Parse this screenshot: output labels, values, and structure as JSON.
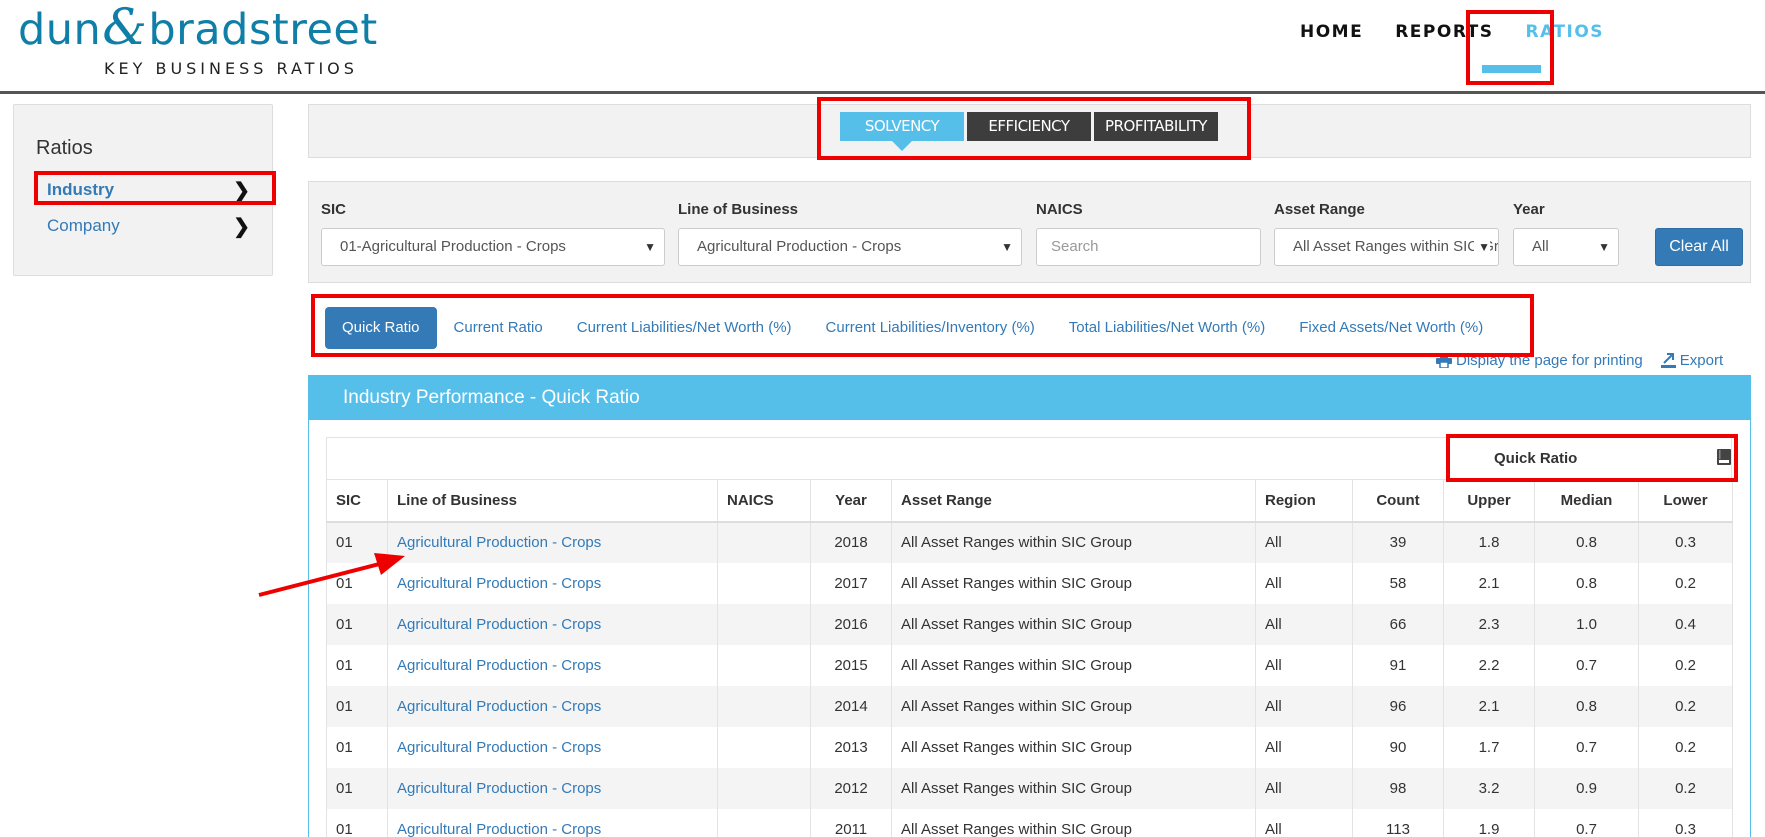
{
  "logo": {
    "part1": "dun",
    "amp": "&",
    "part2": "bradstreet",
    "subtitle": "KEY BUSINESS RATIOS"
  },
  "nav": {
    "items": [
      "HOME",
      "REPORTS",
      "RATIOS"
    ],
    "active": 2
  },
  "sidebar": {
    "title": "Ratios",
    "items": [
      {
        "label": "Industry",
        "active": true
      },
      {
        "label": "Company",
        "active": false
      }
    ],
    "chevron": "›"
  },
  "categories": {
    "tabs": [
      "SOLVENCY",
      "EFFICIENCY",
      "PROFITABILITY"
    ],
    "active": 0
  },
  "filters": {
    "sic": {
      "label": "SIC",
      "value": "01-Agricultural Production - Crops"
    },
    "lob": {
      "label": "Line of Business",
      "value": "Agricultural Production - Crops"
    },
    "naics": {
      "label": "NAICS",
      "placeholder": "Search"
    },
    "asset": {
      "label": "Asset Range",
      "value": "All Asset Ranges within SIC Group"
    },
    "year": {
      "label": "Year",
      "value": "All"
    },
    "clear_label": "Clear All"
  },
  "ratio_tabs": {
    "tabs": [
      "Quick Ratio",
      "Current Ratio",
      "Current Liabilities/Net Worth (%)",
      "Current Liabilities/Inventory (%)",
      "Total Liabilities/Net Worth (%)",
      "Fixed Assets/Net Worth (%)"
    ],
    "active": 0
  },
  "actions": {
    "print": "Display the page for printing",
    "export": "Export",
    "print_icon": "printer-icon",
    "export_icon": "export-icon"
  },
  "panel": {
    "title": "Industry Performance - Quick Ratio",
    "group_header": "Quick Ratio",
    "group_icon": "book-icon",
    "columns": [
      "SIC",
      "Line of Business",
      "NAICS",
      "Year",
      "Asset Range",
      "Region",
      "Count",
      "Upper",
      "Median",
      "Lower"
    ],
    "rows": [
      [
        "01",
        "Agricultural Production - Crops",
        "",
        "2018",
        "All Asset Ranges within SIC Group",
        "All",
        "39",
        "1.8",
        "0.8",
        "0.3"
      ],
      [
        "01",
        "Agricultural Production - Crops",
        "",
        "2017",
        "All Asset Ranges within SIC Group",
        "All",
        "58",
        "2.1",
        "0.8",
        "0.2"
      ],
      [
        "01",
        "Agricultural Production - Crops",
        "",
        "2016",
        "All Asset Ranges within SIC Group",
        "All",
        "66",
        "2.3",
        "1.0",
        "0.4"
      ],
      [
        "01",
        "Agricultural Production - Crops",
        "",
        "2015",
        "All Asset Ranges within SIC Group",
        "All",
        "91",
        "2.2",
        "0.7",
        "0.2"
      ],
      [
        "01",
        "Agricultural Production - Crops",
        "",
        "2014",
        "All Asset Ranges within SIC Group",
        "All",
        "96",
        "2.1",
        "0.8",
        "0.2"
      ],
      [
        "01",
        "Agricultural Production - Crops",
        "",
        "2013",
        "All Asset Ranges within SIC Group",
        "All",
        "90",
        "1.7",
        "0.7",
        "0.2"
      ],
      [
        "01",
        "Agricultural Production - Crops",
        "",
        "2012",
        "All Asset Ranges within SIC Group",
        "All",
        "98",
        "3.2",
        "0.9",
        "0.2"
      ],
      [
        "01",
        "Agricultural Production - Crops",
        "",
        "2011",
        "All Asset Ranges within SIC Group",
        "All",
        "113",
        "1.9",
        "0.7",
        "0.3"
      ]
    ]
  },
  "colors": {
    "accent": "#55bfea",
    "link": "#337ab7",
    "dark_tab": "#3d3d3d",
    "annotation": "#ee0000"
  }
}
